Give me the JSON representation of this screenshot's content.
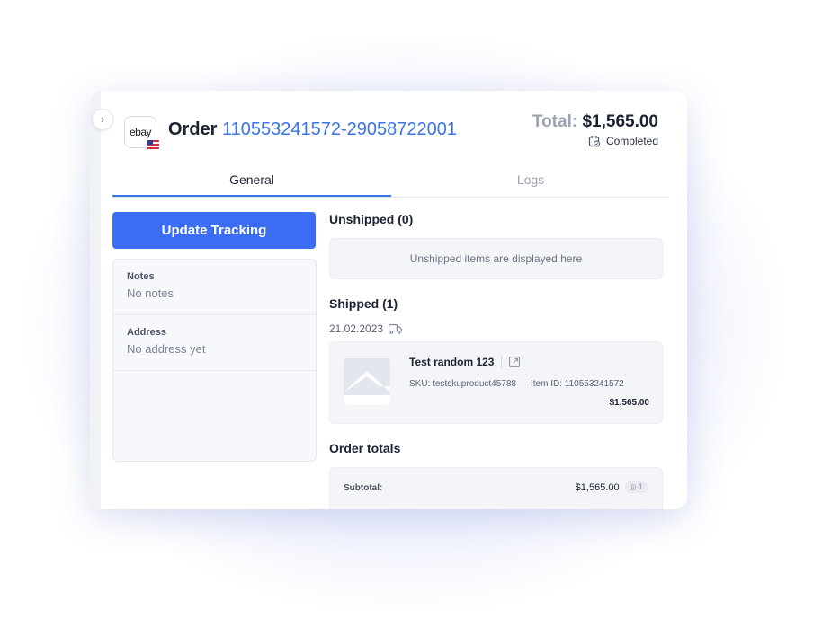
{
  "order": {
    "prefix": "Order",
    "id": "110553241572-29058722001",
    "marketplace_logo": "ebay",
    "country_flag": "us-flag-icon"
  },
  "total": {
    "label": "Total:",
    "value": "$1,565.00",
    "status": "Completed"
  },
  "tabs": [
    {
      "label": "General",
      "active": true
    },
    {
      "label": "Logs",
      "active": false
    }
  ],
  "actions": {
    "update_tracking": "Update Tracking"
  },
  "info": {
    "notes_label": "Notes",
    "notes_value": "No notes",
    "address_label": "Address",
    "address_value": "No address yet"
  },
  "unshipped": {
    "heading": "Unshipped (0)",
    "empty_text": "Unshipped items are displayed here"
  },
  "shipped": {
    "heading": "Shipped (1)",
    "date": "21.02.2023",
    "item": {
      "name": "Test random 123",
      "sku": "SKU: testskuproduct45788",
      "item_id": "Item ID: 110553241572",
      "price": "$1,565.00"
    }
  },
  "totals": {
    "heading": "Order totals",
    "subtotal_label": "Subtotal:",
    "subtotal_value": "$1,565.00",
    "subtotal_qty": "1"
  },
  "colors": {
    "accent": "#3a6cf4",
    "link": "#3b73ea",
    "muted": "#9aa3b3"
  }
}
